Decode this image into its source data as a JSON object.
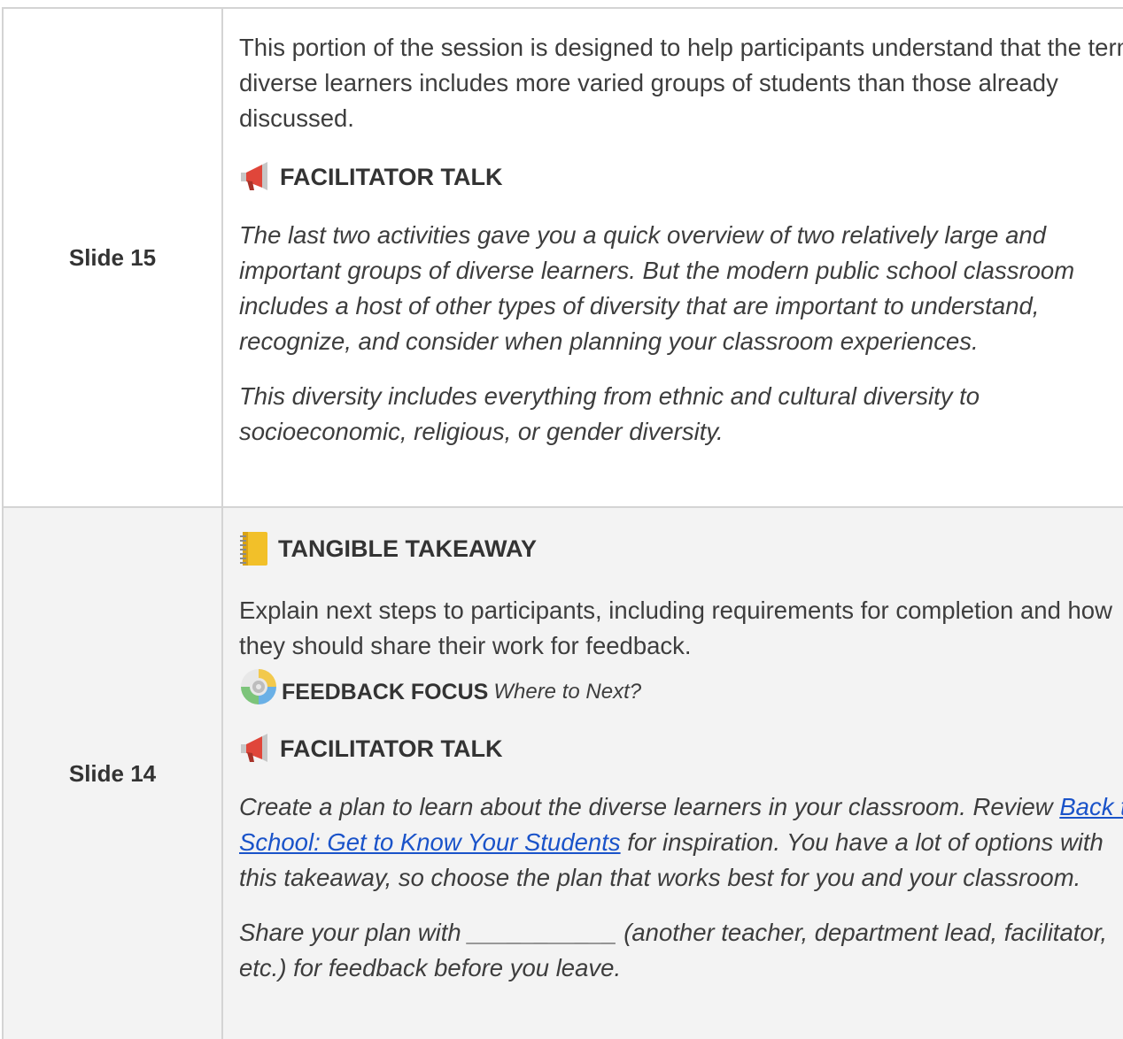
{
  "rows": [
    {
      "label": "Slide 15",
      "intro": "This portion of the session is designed to help participants understand that the term diverse learners includes more varied groups of students than those already discussed.",
      "facilitator_heading": "FACILITATOR TALK",
      "talk_paragraphs": [
        "The last two activities gave you a quick overview of two relatively large and important groups of diverse learners. But the modern public school classroom includes a host of other types of diversity that are important to understand, recognize, and consider when planning your classroom experiences.",
        "This diversity includes everything from ethnic and cultural diversity to socioeconomic, religious, or gender diversity."
      ]
    },
    {
      "label": "Slide 14",
      "takeaway_heading": "TANGIBLE TAKEAWAY",
      "explain": "Explain next steps to participants, including requirements for completion and how they should share their work for feedback.",
      "feedback_label": "FEEDBACK FOCUS",
      "feedback_sub": "Where to Next?",
      "facilitator_heading": "FACILITATOR TALK",
      "plan_before": "Create a plan to learn about the diverse learners in your classroom. Review ",
      "plan_link": "Back to School: Get to Know Your Students",
      "plan_after": " for inspiration. You have a lot of options with this takeaway, so choose the plan that works best for you and your classroom.",
      "share": "Share your plan with ___________ (another teacher, department lead, facilitator, etc.) for feedback before you leave."
    }
  ],
  "icons": {
    "megaphone": "megaphone-icon",
    "notebook": "notebook-icon",
    "feedback_cycle": "feedback-cycle-icon"
  },
  "colors": {
    "link": "#1a53c9",
    "border": "#d4d4d4",
    "shaded_row": "#f3f3f3"
  }
}
